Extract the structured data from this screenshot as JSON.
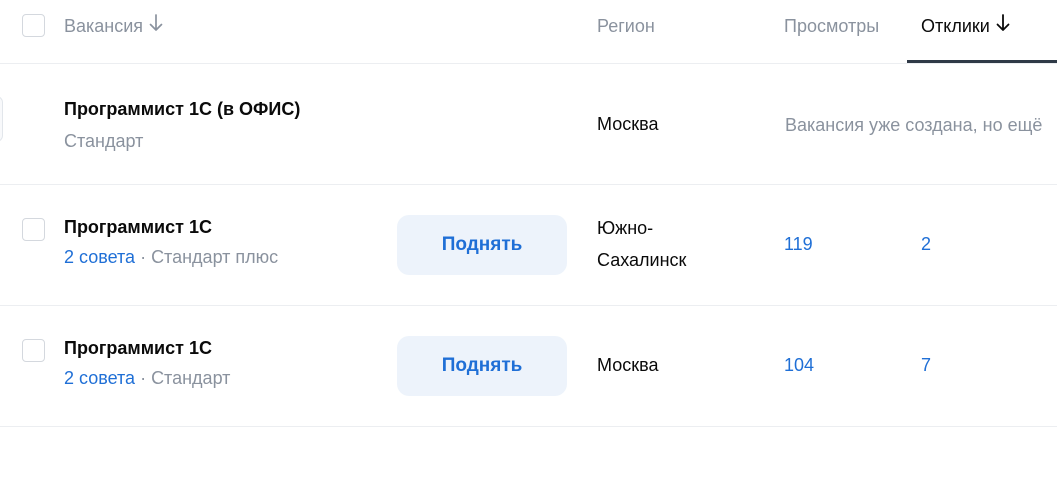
{
  "header": {
    "vacancy_label": "Вакансия",
    "region_label": "Регион",
    "views_label": "Просмотры",
    "responses_label": "Отклики"
  },
  "rows": [
    {
      "title": "Программист 1С (в ОФИС)",
      "tariff": "Стандарт",
      "region": "Москва",
      "status": "Вакансия уже создана, но ещё"
    },
    {
      "title": "Программист 1С",
      "tips": "2 совета",
      "separator": " · ",
      "tariff": "Стандарт плюс",
      "raise_label": "Поднять",
      "region_line1": "Южно-",
      "region_line2": "Сахалинск",
      "views": "119",
      "responses": "2"
    },
    {
      "title": "Программист 1С",
      "tips": "2 совета",
      "separator": " · ",
      "tariff": "Стандарт",
      "raise_label": "Поднять",
      "region": "Москва",
      "views": "104",
      "responses": "7"
    }
  ],
  "colors": {
    "accent": "#1f6fd6",
    "muted": "#8a929e",
    "button_bg": "#edf3fb",
    "active_underline": "#2f3a47"
  }
}
